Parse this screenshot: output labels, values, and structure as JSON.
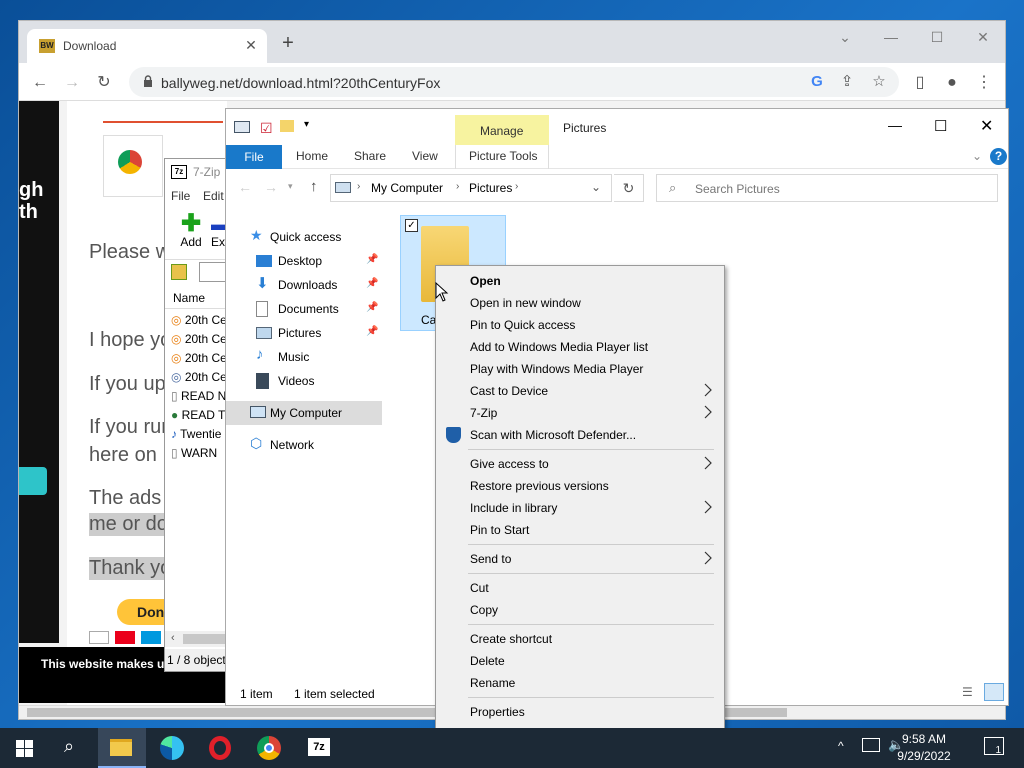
{
  "chrome": {
    "tab_title": "Download",
    "tab_favicon": "BW",
    "new_tab": "+",
    "url": "ballyweg.net/download.html?20thCenturyFox",
    "window_controls": [
      "chevron-down-icon",
      "minimize-icon",
      "maximize-icon",
      "close-icon"
    ]
  },
  "webpage": {
    "left_words": [
      "gh",
      "th"
    ],
    "lines": [
      "Please w",
      "I hope yo",
      "If you up",
      "If you rur",
      "here on",
      "The ads",
      "me or do",
      "Thank yo"
    ],
    "donate_label": "Don",
    "cookie_text": "This website makes u"
  },
  "zip": {
    "title": "7-Zip",
    "title_icon": "7z",
    "menu": [
      "File",
      "Edit"
    ],
    "tools": [
      {
        "label": "Add",
        "icon": "plus-icon"
      },
      {
        "label": "Ext",
        "icon": "minus-icon"
      }
    ],
    "column": "Name",
    "rows": [
      {
        "name": "20th Ce",
        "icon": "blender-icon"
      },
      {
        "name": "20th Ce",
        "icon": "blender-icon"
      },
      {
        "name": "20th Ce",
        "icon": "blender-icon"
      },
      {
        "name": "20th Ce",
        "icon": "blender-icon"
      },
      {
        "name": "READ N",
        "icon": "text-file-icon"
      },
      {
        "name": "READ T",
        "icon": "globe-icon"
      },
      {
        "name": "Twentie",
        "icon": "audio-file-icon"
      },
      {
        "name": "WARN",
        "icon": "text-file-icon"
      }
    ],
    "status": "1 / 8 object"
  },
  "explorer": {
    "manage_label": "Manage",
    "window_title": "Pictures",
    "ribbon_tabs": [
      "File",
      "Home",
      "Share",
      "View"
    ],
    "picture_tools": "Picture Tools",
    "help": "?",
    "breadcrumb": [
      "My Computer",
      "Pictures"
    ],
    "search_placeholder": "Search Pictures",
    "nav": [
      {
        "label": "Quick access",
        "icon": "star-icon",
        "main": true
      },
      {
        "label": "Desktop",
        "icon": "desktop-icon",
        "pinned": true
      },
      {
        "label": "Downloads",
        "icon": "download-arrow-icon",
        "pinned": true
      },
      {
        "label": "Documents",
        "icon": "document-icon",
        "pinned": true
      },
      {
        "label": "Pictures",
        "icon": "pictures-icon",
        "pinned": true
      },
      {
        "label": "Music",
        "icon": "music-note-icon"
      },
      {
        "label": "Videos",
        "icon": "film-icon"
      },
      {
        "label": "My Computer",
        "icon": "computer-icon",
        "main": true,
        "selected": true
      },
      {
        "label": "Network",
        "icon": "network-icon",
        "main": true
      }
    ],
    "folder_label": "Ca",
    "status_items": "1 item",
    "status_selected": "1 item selected"
  },
  "context_menu": {
    "groups": [
      [
        {
          "label": "Open",
          "bold": true
        },
        {
          "label": "Open in new window"
        },
        {
          "label": "Pin to Quick access"
        },
        {
          "label": "Add to Windows Media Player list"
        },
        {
          "label": "Play with Windows Media Player"
        },
        {
          "label": "Cast to Device",
          "submenu": true
        },
        {
          "label": "7-Zip",
          "submenu": true
        },
        {
          "label": "Scan with Microsoft Defender...",
          "icon": "defender-shield-icon"
        }
      ],
      [
        {
          "label": "Give access to",
          "submenu": true
        },
        {
          "label": "Restore previous versions"
        },
        {
          "label": "Include in library",
          "submenu": true
        },
        {
          "label": "Pin to Start"
        }
      ],
      [
        {
          "label": "Send to",
          "submenu": true
        }
      ],
      [
        {
          "label": "Cut"
        },
        {
          "label": "Copy"
        }
      ],
      [
        {
          "label": "Create shortcut"
        },
        {
          "label": "Delete"
        },
        {
          "label": "Rename"
        }
      ],
      [
        {
          "label": "Properties"
        }
      ]
    ]
  },
  "taskbar": {
    "time": "9:58 AM",
    "date": "9/29/2022",
    "notification_count": "1",
    "apps": [
      "file-explorer-icon",
      "edge-icon",
      "opera-icon",
      "chrome-icon",
      "7zip-icon"
    ]
  }
}
